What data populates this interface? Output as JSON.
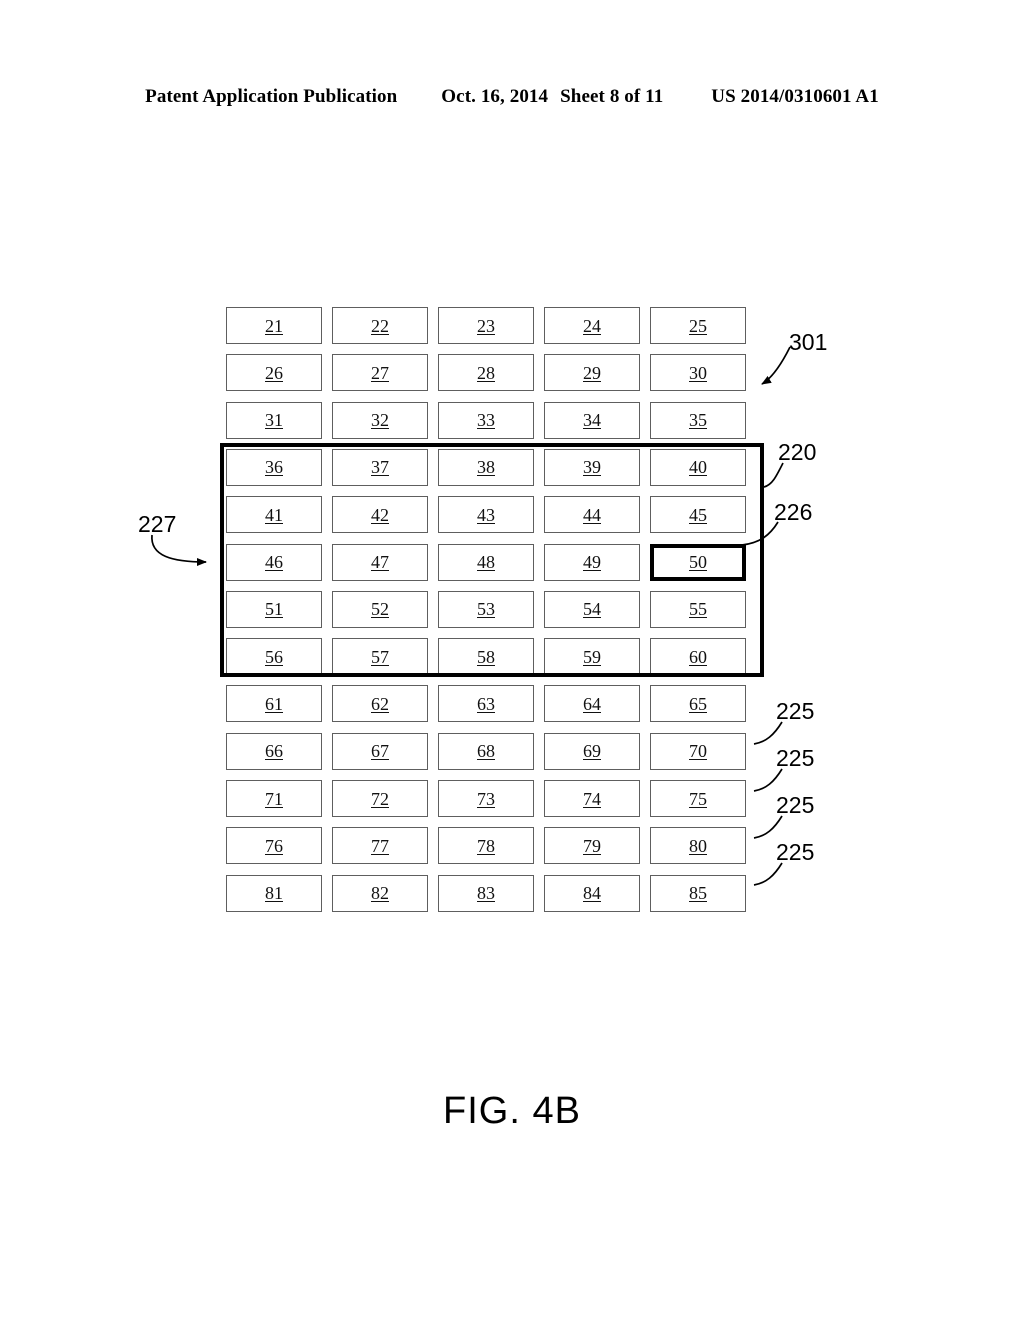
{
  "header": {
    "publication": "Patent Application Publication",
    "date": "Oct. 16, 2014",
    "sheet": "Sheet 8 of 11",
    "patent_number": "US 2014/0310601 A1"
  },
  "figure": {
    "caption": "FIG. 4B",
    "grid": {
      "columns": 5,
      "rows": 13,
      "cells": [
        [
          "21",
          "22",
          "23",
          "24",
          "25"
        ],
        [
          "26",
          "27",
          "28",
          "29",
          "30"
        ],
        [
          "31",
          "32",
          "33",
          "34",
          "35"
        ],
        [
          "36",
          "37",
          "38",
          "39",
          "40"
        ],
        [
          "41",
          "42",
          "43",
          "44",
          "45"
        ],
        [
          "46",
          "47",
          "48",
          "49",
          "50"
        ],
        [
          "51",
          "52",
          "53",
          "54",
          "55"
        ],
        [
          "56",
          "57",
          "58",
          "59",
          "60"
        ],
        [
          "61",
          "62",
          "63",
          "64",
          "65"
        ],
        [
          "66",
          "67",
          "68",
          "69",
          "70"
        ],
        [
          "71",
          "72",
          "73",
          "74",
          "75"
        ],
        [
          "76",
          "77",
          "78",
          "79",
          "80"
        ],
        [
          "81",
          "82",
          "83",
          "84",
          "85"
        ]
      ],
      "selected_cell": "50"
    },
    "callouts": {
      "ref_301": "301",
      "ref_220": "220",
      "ref_226": "226",
      "ref_227": "227",
      "ref_225_a": "225",
      "ref_225_b": "225",
      "ref_225_c": "225",
      "ref_225_d": "225"
    }
  },
  "colors": {
    "ink": "#000000",
    "cell_border": "#5e5e5e",
    "page": "#ffffff"
  }
}
